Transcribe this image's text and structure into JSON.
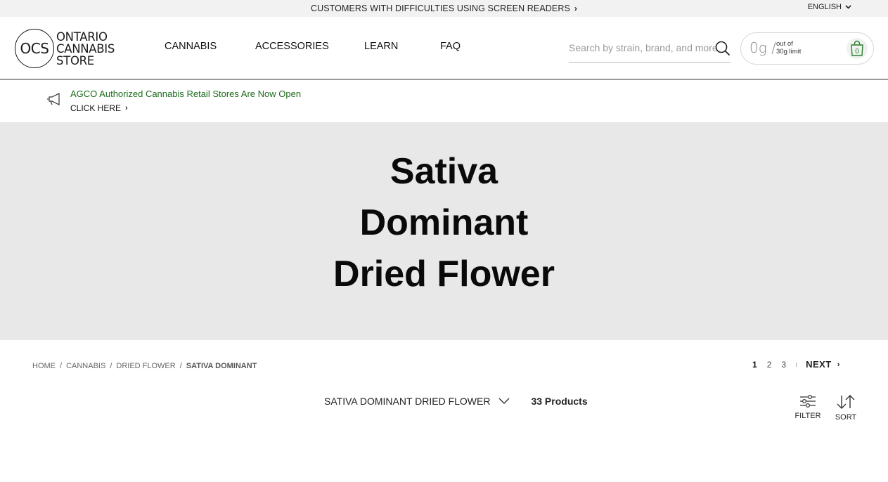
{
  "topbar": {
    "accessibility_link": "CUSTOMERS WITH DIFFICULTIES USING SCREEN READERS",
    "language": "ENGLISH"
  },
  "header": {
    "logo_mark": "OCS",
    "logo_line1": "ONTARIO",
    "logo_line2": "CANNABIS",
    "logo_line3": "STORE",
    "nav": [
      "CANNABIS",
      "ACCESSORIES",
      "LEARN",
      "FAQ"
    ],
    "search": {
      "placeholder": "Search by strain, brand, and more",
      "value": ""
    },
    "cart": {
      "grams": "0g",
      "slash": "/",
      "limit_line1": "out of",
      "limit_line2": "30g limit",
      "item_count": "0"
    }
  },
  "announcement": {
    "message": "AGCO Authorized Cannabis Retail Stores Are Now Open",
    "cta": "CLICK HERE"
  },
  "hero": {
    "title_lines": [
      "Sativa",
      "Dominant",
      "Dried Flower"
    ]
  },
  "breadcrumb": [
    "HOME",
    "CANNABIS",
    "DRIED FLOWER",
    "SATIVA DOMINANT"
  ],
  "pagination": {
    "pages": [
      "1",
      "2",
      "3"
    ],
    "current": "1",
    "next": "NEXT"
  },
  "listing": {
    "category": "SATIVA DOMINANT DRIED FLOWER",
    "count": "33 Products",
    "filter_label": "FILTER",
    "sort_label": "SORT"
  },
  "colors": {
    "accent_green": "#1d6b1d",
    "hero_bg": "#e8e8e8",
    "topbar_bg": "#f2f2f2"
  }
}
